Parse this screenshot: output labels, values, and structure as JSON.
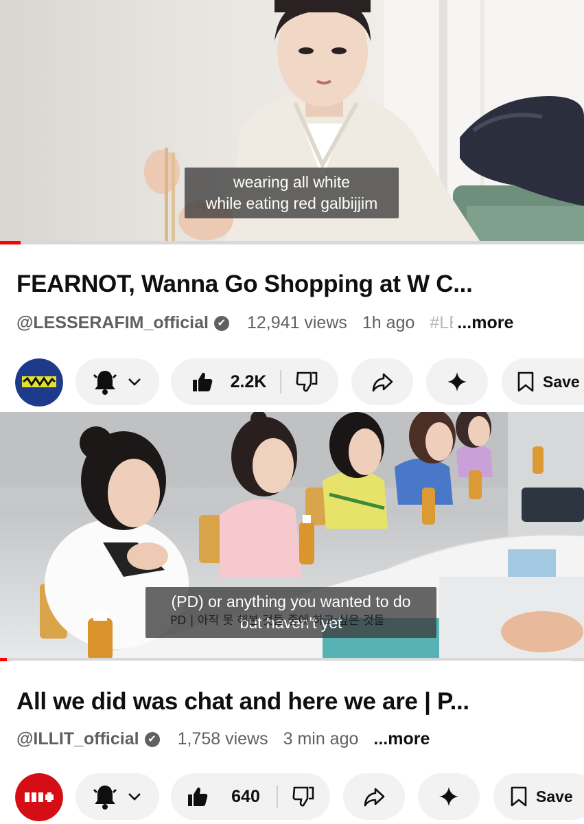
{
  "videos": [
    {
      "caption_line1": "wearing all white",
      "caption_line2": "while eating red galbijjim",
      "progress_fraction": 0.035,
      "title": "FEARNOT, Wanna Go Shopping at W C...",
      "channel": "@LESSERAFIM_official",
      "verified_glyph": "✔",
      "views": "12,941 views",
      "age": "1h ago",
      "hashtag": "#LE",
      "more": "...more",
      "likes": "2.2K",
      "save": "Save",
      "icons": [
        "bell-icon",
        "chevron-down-icon",
        "thumbs-up-icon",
        "thumbs-down-icon",
        "share-icon",
        "sparkle-icon",
        "bookmark-icon"
      ]
    },
    {
      "caption_line1": "(PD) or anything you wanted to do",
      "caption_line2": "but haven't yet",
      "hardsub": "PD | 아직 못 해본 것들 중에 하고 싶은 것들",
      "progress_fraction": 0.012,
      "title": "All we did was chat and here we are | P...",
      "channel": "@ILLIT_official",
      "verified_glyph": "✔",
      "views": "1,758 views",
      "age": "3 min ago",
      "more": "...more",
      "likes": "640",
      "save": "Save",
      "icons": [
        "bell-icon",
        "chevron-down-icon",
        "thumbs-up-icon",
        "thumbs-down-icon",
        "share-icon",
        "sparkle-icon",
        "bookmark-icon"
      ]
    }
  ],
  "colors": {
    "progress": "#ff0000",
    "pill": "#f2f2f2",
    "meta": "#606060",
    "lesserafim_avatar": "#1e3a8a",
    "illit_avatar": "#d40e14"
  }
}
